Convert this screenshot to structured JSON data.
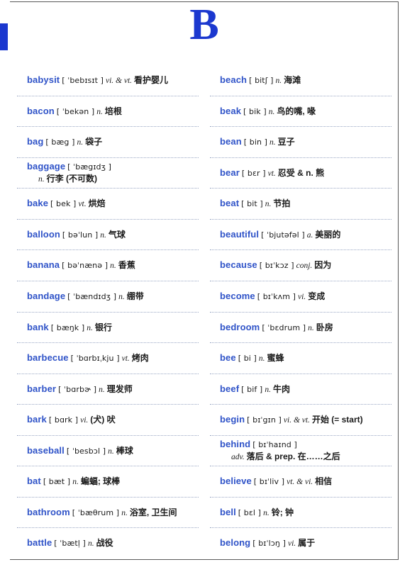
{
  "page": {
    "letter": "B",
    "accent_color": "#2f53c8",
    "tab_color": "#1b38cf"
  },
  "columns": [
    {
      "name": "left-column",
      "entries": [
        {
          "word": "babysit",
          "phonetic": "[ ˈbebɪsɪt ]",
          "pos": "vi. & vt.",
          "definition": "看护婴儿"
        },
        {
          "word": "bacon",
          "phonetic": "[ ˈbekən ]",
          "pos": "n.",
          "definition": "培根"
        },
        {
          "word": "bag",
          "phonetic": "[ bæg ]",
          "pos": "n.",
          "definition": "袋子"
        },
        {
          "word": "baggage",
          "phonetic": "[ ˈbægɪdʒ ]",
          "pos": "n.",
          "definition": "行李 (不可数)",
          "wrap": true
        },
        {
          "word": "bake",
          "phonetic": "[ bek ]",
          "pos": "vt.",
          "definition": "烘焙"
        },
        {
          "word": "balloon",
          "phonetic": "[ bəˈlun ]",
          "pos": "n.",
          "definition": "气球"
        },
        {
          "word": "banana",
          "phonetic": "[ bəˈnænə ]",
          "pos": "n.",
          "definition": "香蕉"
        },
        {
          "word": "bandage",
          "phonetic": "[ ˈbændɪdʒ ]",
          "pos": "n.",
          "definition": "绷带"
        },
        {
          "word": "bank",
          "phonetic": "[ bæŋk ]",
          "pos": "n.",
          "definition": "银行"
        },
        {
          "word": "barbecue",
          "phonetic": "[ ˈbɑrbɪˌkju ]",
          "pos": "vt.",
          "definition": "烤肉"
        },
        {
          "word": "barber",
          "phonetic": "[ ˈbɑrbɚ ]",
          "pos": "n.",
          "definition": "理发师"
        },
        {
          "word": "bark",
          "phonetic": "[ bɑrk ]",
          "pos": "vi.",
          "definition": "(犬) 吠"
        },
        {
          "word": "baseball",
          "phonetic": "[ ˈbesbɔl ]",
          "pos": "n.",
          "definition": "棒球"
        },
        {
          "word": "bat",
          "phonetic": "[ bæt ]",
          "pos": "n.",
          "definition": "蝙蝠; 球棒"
        },
        {
          "word": "bathroom",
          "phonetic": "[ ˈbæθrum ]",
          "pos": "n.",
          "definition": "浴室, 卫生间"
        },
        {
          "word": "battle",
          "phonetic": "[ ˈbætl̩ ]",
          "pos": "n.",
          "definition": "战役"
        }
      ]
    },
    {
      "name": "right-column",
      "entries": [
        {
          "word": "beach",
          "phonetic": "[ bitʃ ]",
          "pos": "n.",
          "definition": "海滩"
        },
        {
          "word": "beak",
          "phonetic": "[ bik ]",
          "pos": "n.",
          "definition": "鸟的嘴, 喙"
        },
        {
          "word": "bean",
          "phonetic": "[ bin ]",
          "pos": "n.",
          "definition": "豆子"
        },
        {
          "word": "bear",
          "phonetic": "[ bɛr ]",
          "pos": "vt.",
          "definition": "忍受 & n. 熊"
        },
        {
          "word": "beat",
          "phonetic": "[ bit ]",
          "pos": "n.",
          "definition": "节拍"
        },
        {
          "word": "beautiful",
          "phonetic": "[ ˈbjutəfəl ]",
          "pos": "a.",
          "definition": "美丽的"
        },
        {
          "word": "because",
          "phonetic": "[ bɪˈkɔz ]",
          "pos": "conj.",
          "definition": "因为"
        },
        {
          "word": "become",
          "phonetic": "[ bɪˈkʌm ]",
          "pos": "vi.",
          "definition": "变成"
        },
        {
          "word": "bedroom",
          "phonetic": "[ ˈbɛdrum ]",
          "pos": "n.",
          "definition": "卧房"
        },
        {
          "word": "bee",
          "phonetic": "[ bi ]",
          "pos": "n.",
          "definition": "蜜蜂"
        },
        {
          "word": "beef",
          "phonetic": "[ bif ]",
          "pos": "n.",
          "definition": "牛肉"
        },
        {
          "word": "begin",
          "phonetic": "[ bɪˈgɪn ]",
          "pos": "vi. & vt.",
          "definition": "开始 (= start)"
        },
        {
          "word": "behind",
          "phonetic": "[ bɪˈhaɪnd ]",
          "pos": "adv.",
          "definition": "落后 & prep. 在……之后",
          "wrap": true
        },
        {
          "word": "believe",
          "phonetic": "[ bɪˈliv ]",
          "pos": "vt. & vi.",
          "definition": "相信"
        },
        {
          "word": "bell",
          "phonetic": "[ bɛl ]",
          "pos": "n.",
          "definition": "铃; 钟"
        },
        {
          "word": "belong",
          "phonetic": "[ bɪˈlɔŋ ]",
          "pos": "vi.",
          "definition": "属于"
        }
      ]
    }
  ]
}
